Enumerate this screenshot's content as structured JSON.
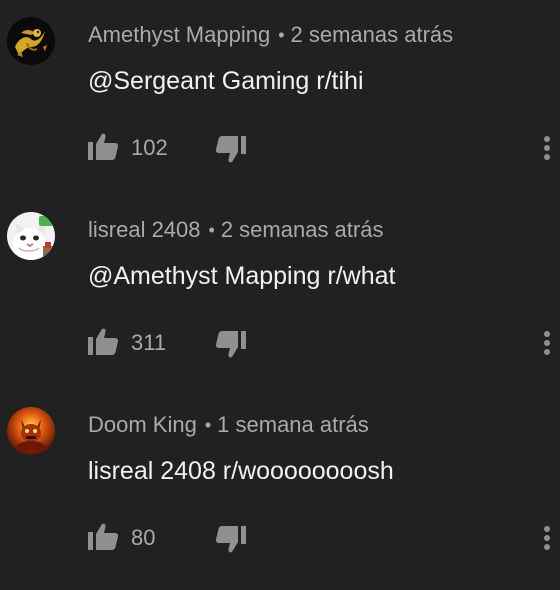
{
  "comments": [
    {
      "author": "Amethyst Mapping",
      "separator": "•",
      "time": "2 semanas atrás",
      "text": "@Sergeant Gaming r/tihi",
      "likes": "102",
      "avatar_icon": "dragon-avatar-icon"
    },
    {
      "author": "lisreal 2408",
      "separator": "•",
      "time": "2 semanas atrás",
      "text": "@Amethyst Mapping r/what",
      "likes": "311",
      "avatar_icon": "cat-avatar-icon"
    },
    {
      "author": "Doom King",
      "separator": "•",
      "time": "1 semana atrás",
      "text": "lisreal 2408 r/woooooooosh",
      "likes": "80",
      "avatar_icon": "doom-avatar-icon"
    }
  ],
  "icons": {
    "like": "thumbs-up-icon",
    "dislike": "thumbs-down-icon",
    "more": "more-vertical-icon"
  },
  "colors": {
    "background": "#212121",
    "meta_text": "#aaaaaa",
    "comment_text": "#f1f1f1",
    "icon": "#909090"
  }
}
